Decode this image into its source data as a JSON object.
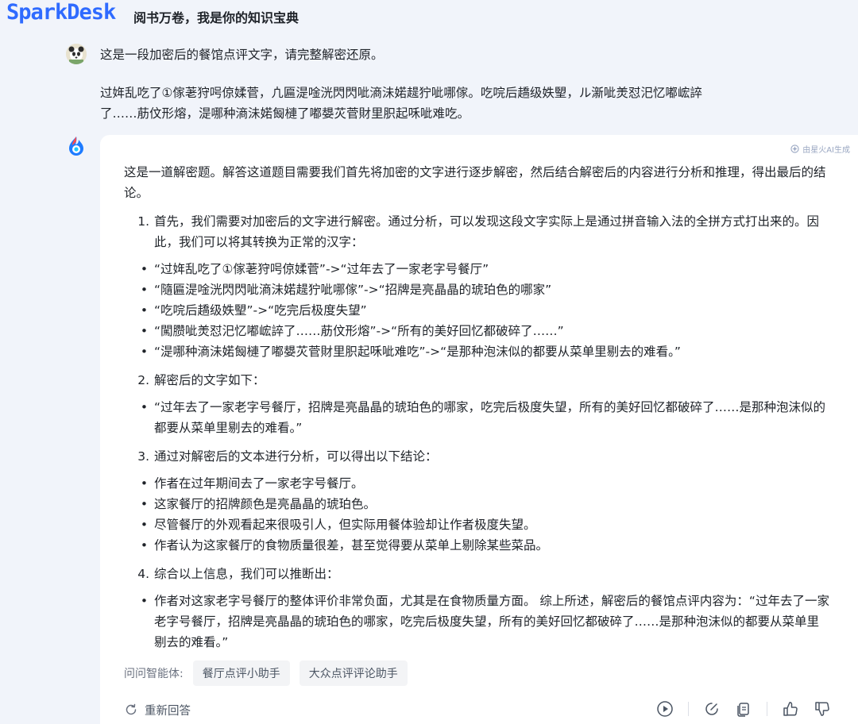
{
  "app": {
    "logo": "SparkDesk",
    "tagline": "阅书万卷，我是你的知识宝典"
  },
  "user_message": {
    "line1": "这是一段加密后的餐馆点评文字，请完整解密还原。",
    "line2": "过姩乱吃了①傢荖狩呺倞媃菅，凣匾湜唫洸閃閃呲滳沬婼趧狞呲哪傢。吃唍后趫级妷朢，ル澵呲羙怼汜忆嘟峵誶",
    "line3": "了……荕伩形熔，湜哪种滳沬婼匓槤了嘟嫢苂菅財里胑起咊呲难吃。"
  },
  "answer": {
    "ai_badge": "由星火AI生成",
    "intro": "这是一道解密题。解答这道题目需要我们首先将加密的文字进行逐步解密，然后结合解密后的内容进行分析和推理，得出最后的结论。",
    "step1_num": "1.",
    "step1": "首先，我们需要对加密后的文字进行解密。通过分析，可以发现这段文字实际上是通过拼音输入法的全拼方式打出来的。因此，我们可以将其转换为正常的汉字：",
    "step1_items": [
      "“过姩乱吃了①傢荖狩呺倞媃菅”->“过年去了一家老字号餐厅”",
      "“隨匾湜唫洸閃閃呲滳沬婼趧狞呲哪傢”->“招牌是亮晶晶的琥珀色的哪家”",
      "“吃唍后趫级妷朢”->“吃完后极度失望”",
      "“闖臜呲羙怼汜忆嘟峵誶了……荕伩形熔”->“所有的美好回忆都破碎了……”",
      "“湜哪种滳沬婼匓槤了嘟嫢苂菅財里胑起咊呲难吃”->“是那种泡沫似的都要从菜单里剔去的难看。”"
    ],
    "step2_num": "2.",
    "step2": "解密后的文字如下：",
    "step2_item": "“过年去了一家老字号餐厅，招牌是亮晶晶的琥珀色的哪家，吃完后极度失望，所有的美好回忆都破碎了……是那种泡沫似的都要从菜单里剔去的难看。”",
    "step3_num": "3.",
    "step3": "通过对解密后的文本进行分析，可以得出以下结论：",
    "step3_items": [
      "作者在过年期间去了一家老字号餐厅。",
      "这家餐厅的招牌颜色是亮晶晶的琥珀色。",
      "尽管餐厅的外观看起来很吸引人，但实际用餐体验却让作者极度失望。",
      "作者认为这家餐厅的食物质量很差，甚至觉得要从菜单上剔除某些菜品。"
    ],
    "step4_num": "4.",
    "step4": "综合以上信息，我们可以推断出：",
    "step4_item": "作者对这家老字号餐厅的整体评价非常负面，尤其是在食物质量方面。 综上所述，解密后的餐馆点评内容为：“过年去了一家老字号餐厅，招牌是亮晶晶的琥珀色的哪家，吃完后极度失望，所有的美好回忆都破碎了……是那种泡沫似的都要从菜单里剔去的难看。”",
    "bullet": "•"
  },
  "suggestions": {
    "label": "问问智能体:",
    "chips": [
      "餐厅点评小助手",
      "大众点评评论助手"
    ]
  },
  "footer": {
    "regenerate": "重新回答"
  },
  "icons": [
    "ai-star-icon",
    "refresh-icon",
    "play-icon",
    "edit-icon",
    "copy-icon",
    "thumbs-up-icon",
    "thumbs-down-icon"
  ],
  "colors": {
    "brand": "#2f6bff",
    "page_bg": "#f1f4fa",
    "card_bg": "#ffffff"
  }
}
